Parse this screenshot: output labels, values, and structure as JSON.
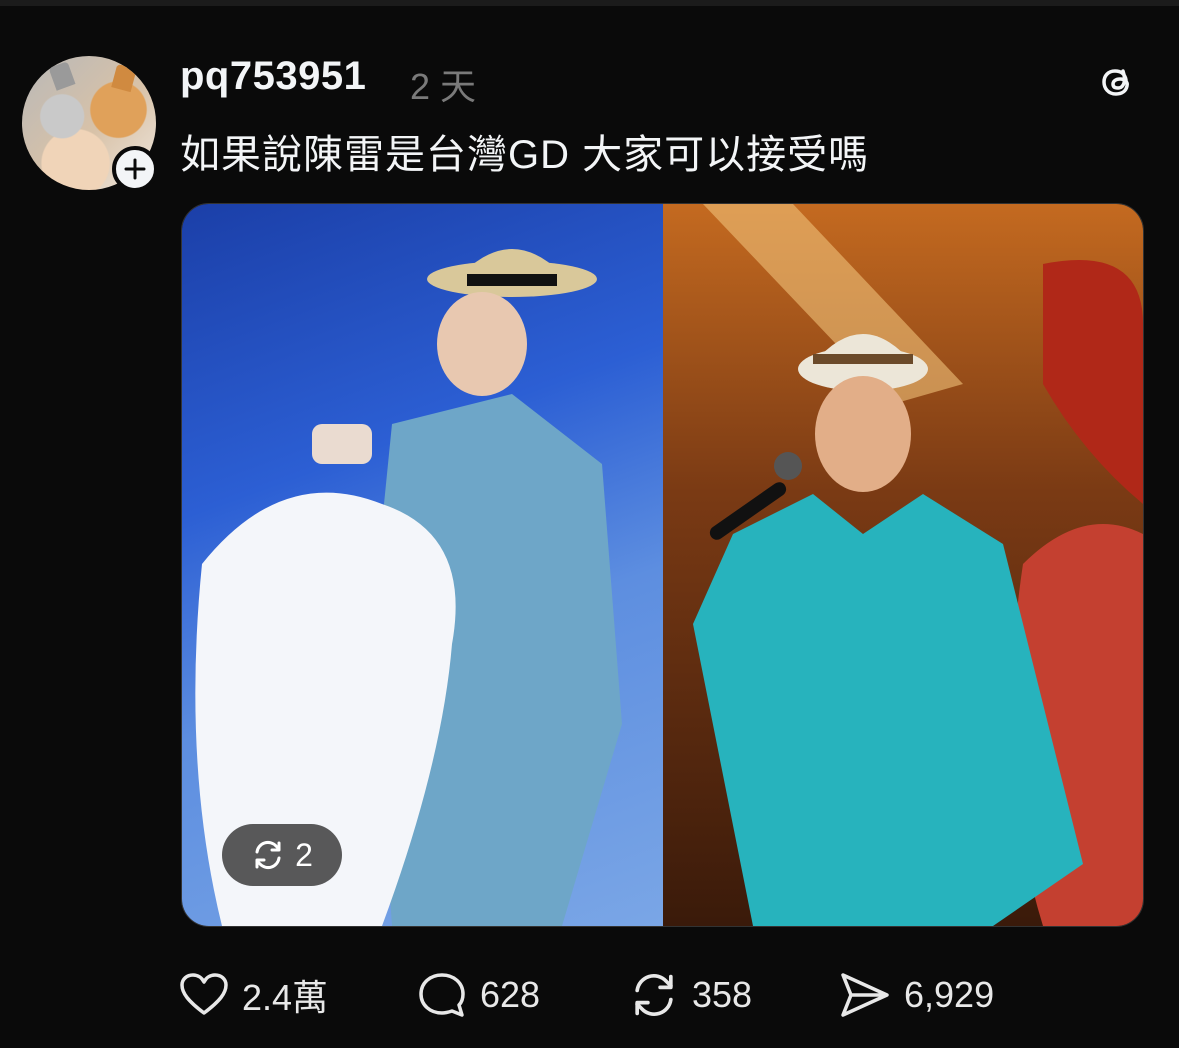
{
  "post": {
    "username": "pq753951",
    "timestamp": "2 天",
    "text": "如果說陳雷是台灣GD 大家可以接受嗎"
  },
  "media": {
    "repost_chip_count": "2"
  },
  "actions": {
    "likes": "2.4萬",
    "replies": "628",
    "reposts": "358",
    "shares": "6,929"
  },
  "icons": {
    "follow": "plus-icon",
    "app": "threads-logo-icon",
    "like": "heart-icon",
    "reply": "comment-icon",
    "repost": "repost-icon",
    "share": "send-icon"
  }
}
